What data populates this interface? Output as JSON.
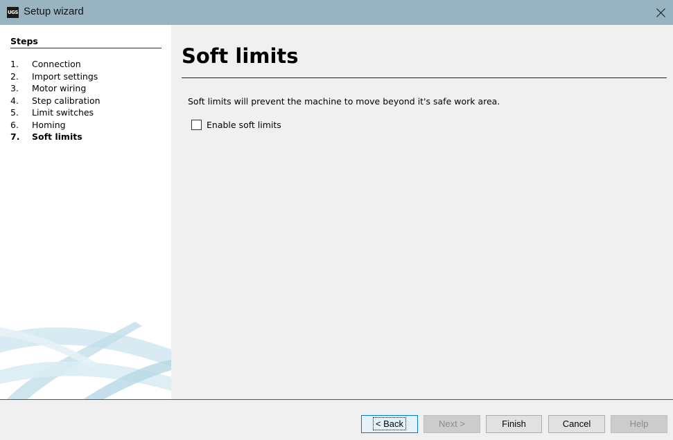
{
  "window": {
    "title": "Setup wizard",
    "icon_text": "UGS",
    "icon": "ugs-app-icon",
    "close_icon": "close-icon"
  },
  "sidebar": {
    "heading": "Steps",
    "steps": [
      {
        "number": "1.",
        "label": "Connection",
        "current": false
      },
      {
        "number": "2.",
        "label": "Import settings",
        "current": false
      },
      {
        "number": "3.",
        "label": "Motor wiring",
        "current": false
      },
      {
        "number": "4.",
        "label": "Step calibration",
        "current": false
      },
      {
        "number": "5.",
        "label": "Limit switches",
        "current": false
      },
      {
        "number": "6.",
        "label": "Homing",
        "current": false
      },
      {
        "number": "7.",
        "label": "Soft limits",
        "current": true
      }
    ]
  },
  "main": {
    "title": "Soft limits",
    "description": "Soft limits will prevent the machine to move beyond it's safe work area.",
    "checkbox": {
      "label": "Enable soft limits",
      "checked": false
    }
  },
  "footer": {
    "buttons": {
      "back": {
        "label": "< Back",
        "enabled": true,
        "focused": true
      },
      "next": {
        "label": "Next >",
        "enabled": false
      },
      "finish": {
        "label": "Finish",
        "enabled": true
      },
      "cancel": {
        "label": "Cancel",
        "enabled": true
      },
      "help": {
        "label": "Help",
        "enabled": false
      }
    }
  },
  "colors": {
    "titlebar": "#99b4c1",
    "sidebar_background": "#ffffff",
    "content_background": "#f0f0f0",
    "focus_border": "#0078d7"
  }
}
